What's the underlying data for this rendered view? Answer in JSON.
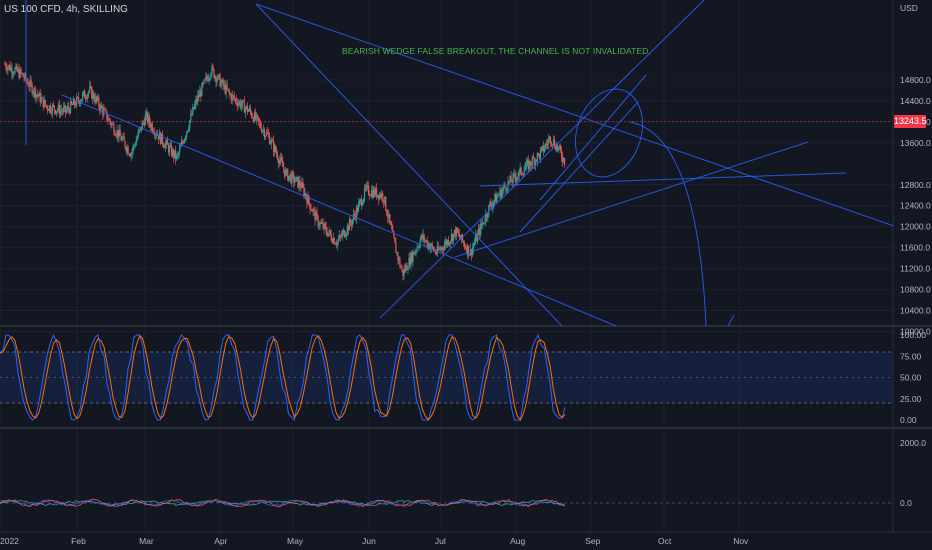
{
  "title": "US 100 CFD, 4h, SKILLING",
  "currency": "USD",
  "annotation": "BEARISH WEDGE FALSE BREAKOUT, THE CHANNEL IS NOT INVALIDATED.",
  "current_price": "13243.5",
  "colors": {
    "background": "#131722",
    "up_candle": "#26a69a",
    "down_candle": "#ef5350",
    "trendline": "#2962ff",
    "annotation": "#4caf50",
    "price_badge": "#f23645",
    "stoch_k": "#2962ff",
    "stoch_d": "#ff6d00",
    "oscillator_line": "#ef5350"
  },
  "x_axis": {
    "labels": [
      "2022",
      "Feb",
      "Mar",
      "Apr",
      "May",
      "Jun",
      "Jul",
      "Aug",
      "Sep",
      "Oct",
      "Nov"
    ]
  },
  "price_axis": {
    "labels": [
      "14800.0",
      "14400.0",
      "14000.0",
      "13600.0",
      "12800.0",
      "12400.0",
      "12000.0",
      "11600.0",
      "11200.0",
      "10800.0",
      "10400.0",
      "10000.0"
    ]
  },
  "stoch_axis": {
    "labels": [
      "100.00",
      "75.00",
      "50.00",
      "25.00",
      "0.00"
    ]
  },
  "osc_axis": {
    "labels": [
      "2000.0",
      "0.0"
    ]
  },
  "chart_data": {
    "type": "candlestick",
    "title": "US 100 CFD, 4h, SKILLING",
    "x_range": [
      "2022-01",
      "2022-11"
    ],
    "y_range": [
      10000,
      15000
    ],
    "price_path": [
      {
        "date": "2022-01-03",
        "price": 15100
      },
      {
        "date": "2022-01-10",
        "price": 14900
      },
      {
        "date": "2022-01-20",
        "price": 14300
      },
      {
        "date": "2022-01-28",
        "price": 14200
      },
      {
        "date": "2022-02-07",
        "price": 14600
      },
      {
        "date": "2022-02-14",
        "price": 14100
      },
      {
        "date": "2022-02-24",
        "price": 13400
      },
      {
        "date": "2022-03-02",
        "price": 14100
      },
      {
        "date": "2022-03-08",
        "price": 13700
      },
      {
        "date": "2022-03-15",
        "price": 13300
      },
      {
        "date": "2022-03-23",
        "price": 14400
      },
      {
        "date": "2022-03-29",
        "price": 15000
      },
      {
        "date": "2022-04-06",
        "price": 14500
      },
      {
        "date": "2022-04-14",
        "price": 14200
      },
      {
        "date": "2022-04-22",
        "price": 13700
      },
      {
        "date": "2022-04-29",
        "price": 13000
      },
      {
        "date": "2022-05-05",
        "price": 12800
      },
      {
        "date": "2022-05-12",
        "price": 12100
      },
      {
        "date": "2022-05-20",
        "price": 11700
      },
      {
        "date": "2022-05-26",
        "price": 12100
      },
      {
        "date": "2022-06-01",
        "price": 12700
      },
      {
        "date": "2022-06-08",
        "price": 12600
      },
      {
        "date": "2022-06-13",
        "price": 11600
      },
      {
        "date": "2022-06-16",
        "price": 11100
      },
      {
        "date": "2022-06-24",
        "price": 11800
      },
      {
        "date": "2022-06-30",
        "price": 11500
      },
      {
        "date": "2022-07-08",
        "price": 11900
      },
      {
        "date": "2022-07-14",
        "price": 11500
      },
      {
        "date": "2022-07-22",
        "price": 12400
      },
      {
        "date": "2022-07-29",
        "price": 12800
      },
      {
        "date": "2022-08-05",
        "price": 13100
      },
      {
        "date": "2022-08-12",
        "price": 13400
      },
      {
        "date": "2022-08-16",
        "price": 13700
      },
      {
        "date": "2022-08-19",
        "price": 13500
      },
      {
        "date": "2022-08-22",
        "price": 13243.5
      }
    ],
    "indicators": [
      {
        "type": "stochastic",
        "range": [
          0,
          100
        ],
        "bands": [
          80,
          20
        ]
      },
      {
        "type": "oscillator",
        "range": [
          -500,
          2500
        ]
      }
    ]
  }
}
